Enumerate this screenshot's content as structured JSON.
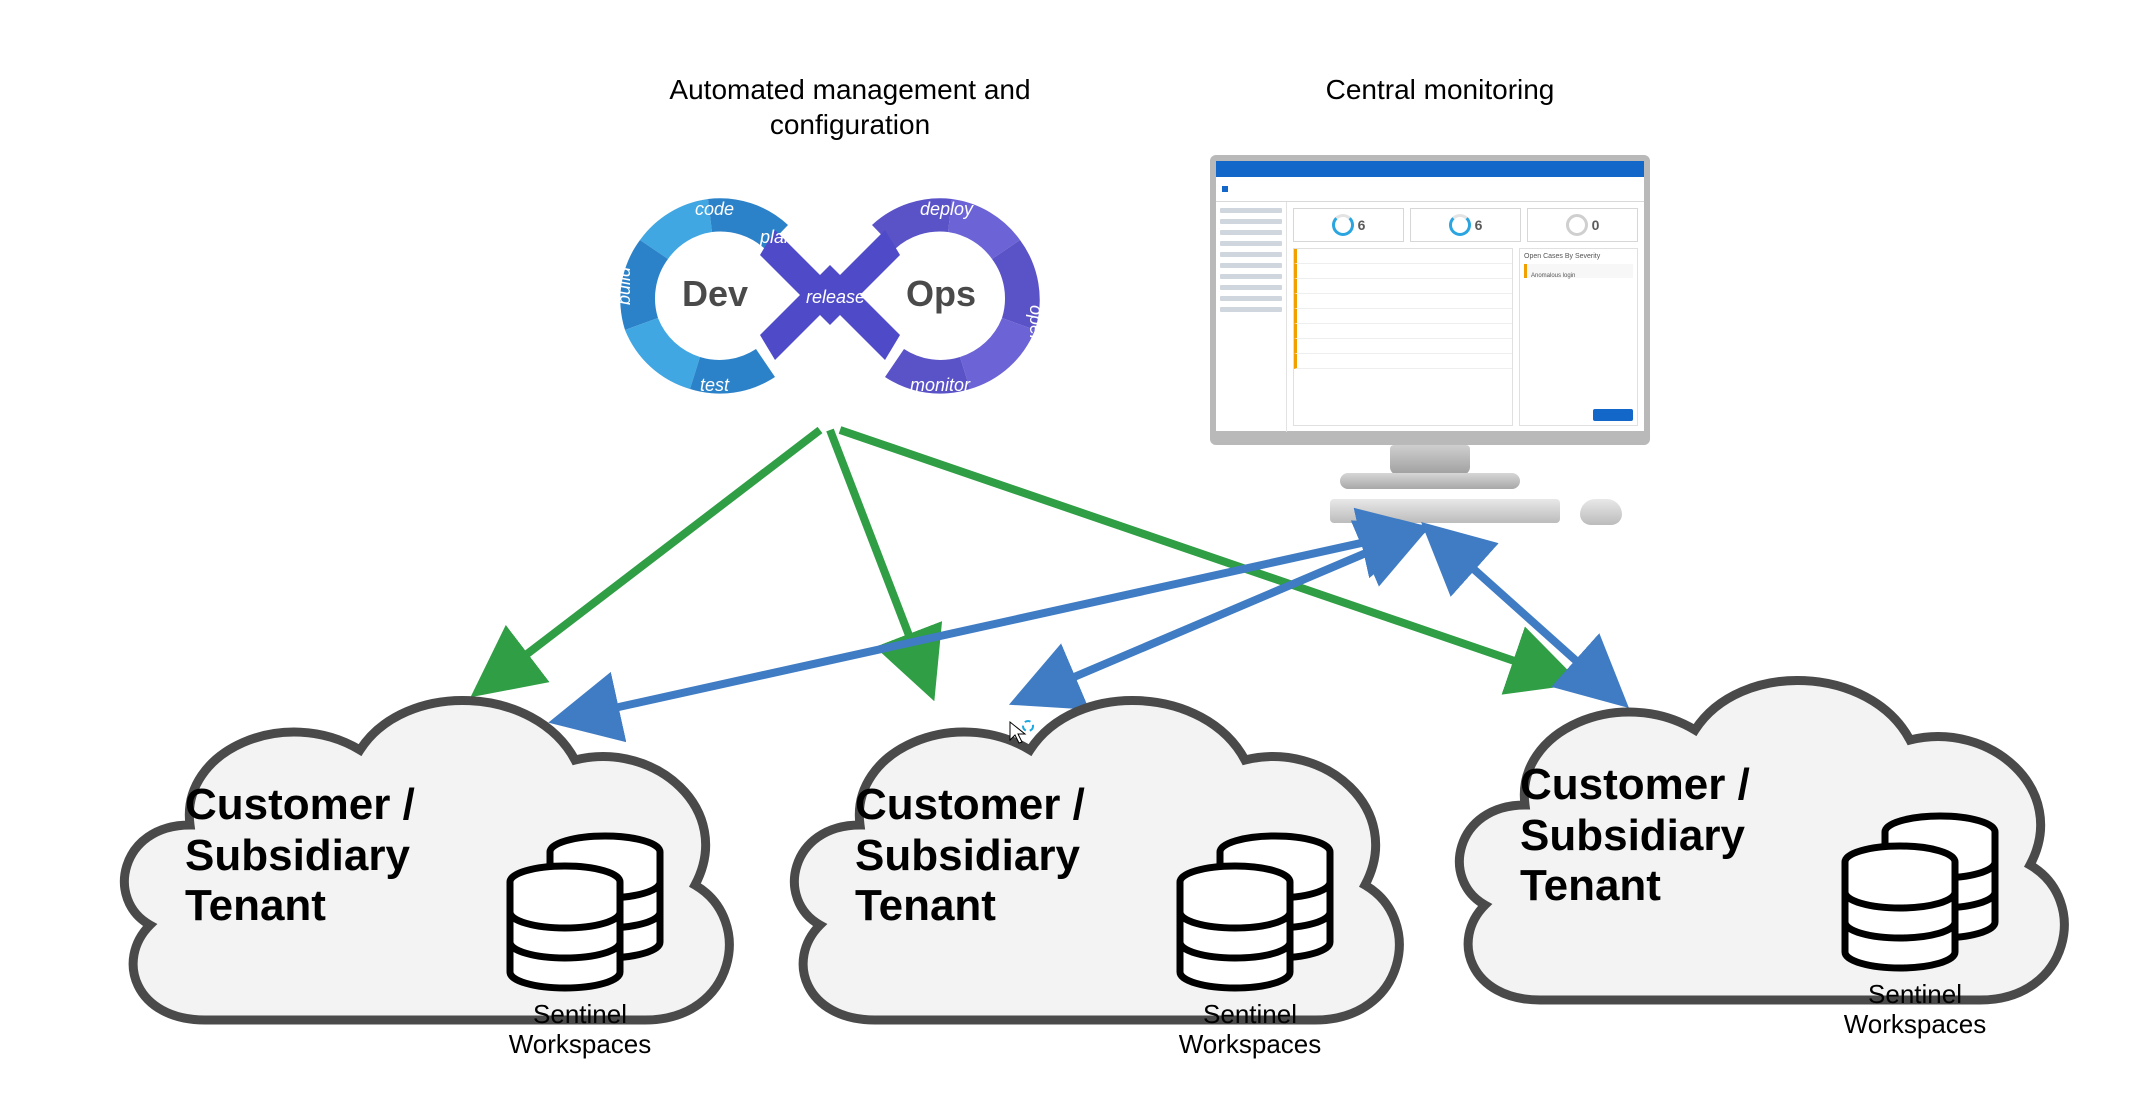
{
  "labels": {
    "automated": "Automated management and configuration",
    "central": "Central monitoring"
  },
  "devops": {
    "left_center": "Dev",
    "right_center": "Ops",
    "segments": {
      "code": "code",
      "plan": "plan",
      "build": "build",
      "test": "test",
      "release": "release",
      "deploy": "deploy",
      "operate": "operate",
      "monitor": "monitor"
    }
  },
  "monitor": {
    "card1": "6",
    "card2": "6",
    "card3": "0",
    "side_header": "Open Cases By Severity",
    "side_item": "Anomalous login"
  },
  "clouds": [
    {
      "title_l1": "Customer /",
      "title_l2": "Subsidiary",
      "title_l3": "Tenant",
      "workspaces_l1": "Sentinel",
      "workspaces_l2": "Workspaces"
    },
    {
      "title_l1": "Customer /",
      "title_l2": "Subsidiary",
      "title_l3": "Tenant",
      "workspaces_l1": "Sentinel",
      "workspaces_l2": "Workspaces"
    },
    {
      "title_l1": "Customer /",
      "title_l2": "Subsidiary",
      "title_l3": "Tenant",
      "workspaces_l1": "Sentinel",
      "workspaces_l2": "Workspaces"
    }
  ],
  "colors": {
    "green": "#2F9E44",
    "blue": "#3F7CC4",
    "dev_light": "#40A7E2",
    "dev_dark": "#2C82C9",
    "ops_light": "#6B63D6",
    "ops_dark": "#5A52C7",
    "release": "#4E4AC8",
    "cloud_fill": "#F3F3F3",
    "cloud_stroke": "#4A4A4A"
  }
}
